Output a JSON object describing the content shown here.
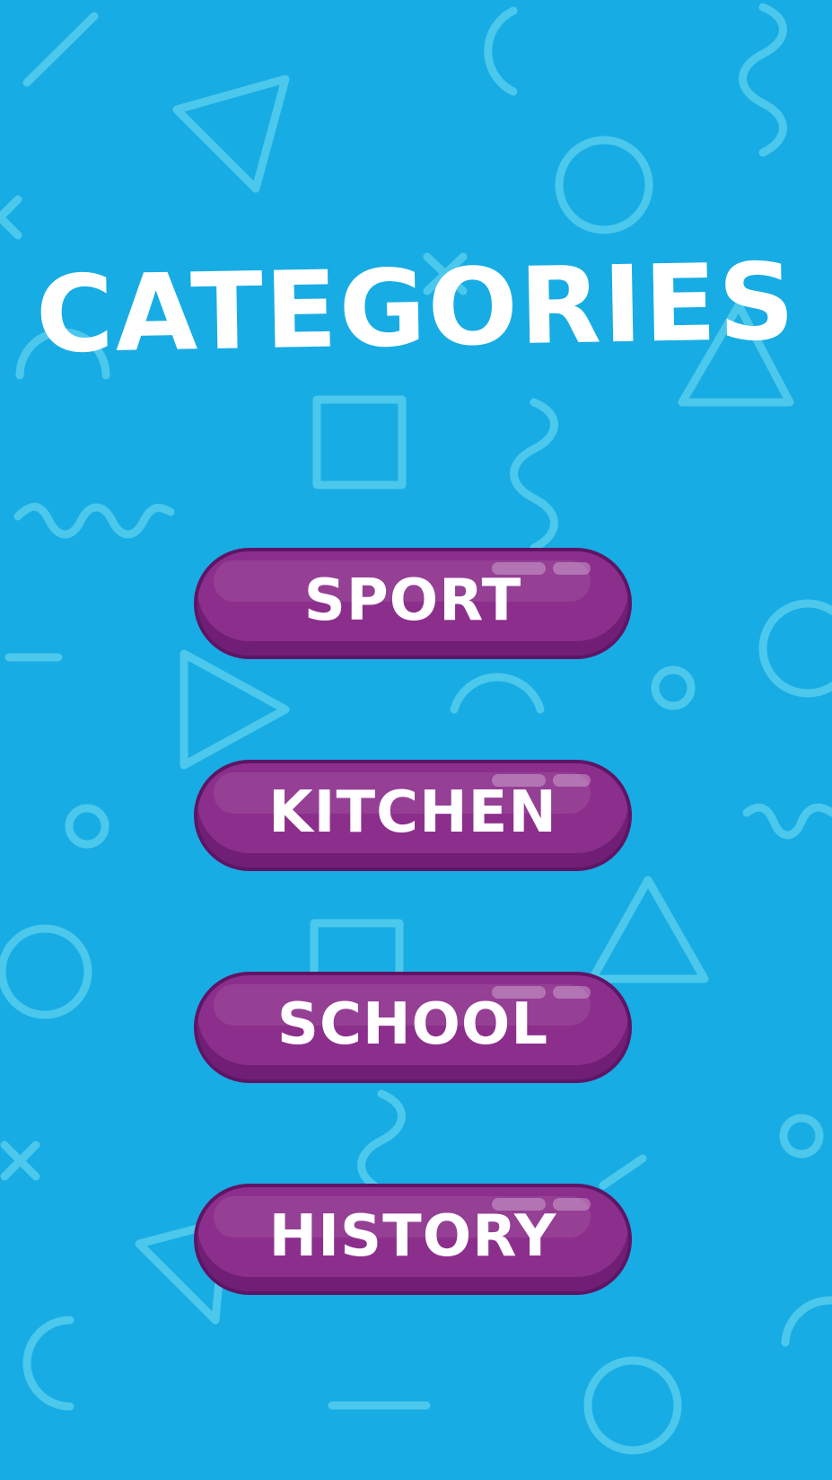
{
  "screen": {
    "title": "CATEGORIES",
    "background_color": "#18ace4",
    "button_color": "#8c2f8c"
  },
  "categories": [
    {
      "label": "SPORT"
    },
    {
      "label": "KITCHEN"
    },
    {
      "label": "SCHOOL"
    },
    {
      "label": "HISTORY"
    }
  ]
}
